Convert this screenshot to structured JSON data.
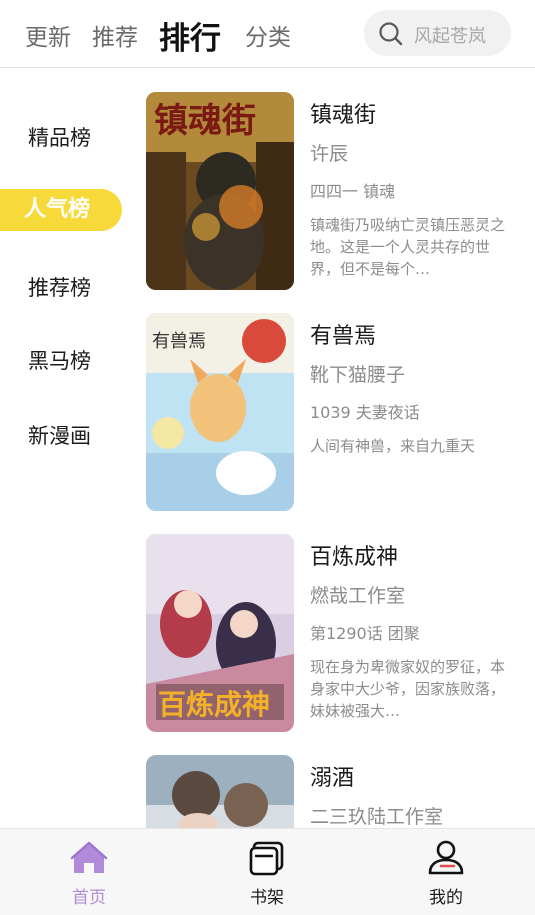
{
  "header": {
    "tabs": [
      "更新",
      "推荐",
      "排行",
      "分类"
    ],
    "active_tab": "排行",
    "search_placeholder": "风起苍岚"
  },
  "sidebar": {
    "items": [
      "精品榜",
      "人气榜",
      "推荐榜",
      "黑马榜",
      "新漫画"
    ],
    "active_item": "人气榜"
  },
  "comics": [
    {
      "title": "镇魂街",
      "author": "许辰",
      "chapter": "四四一 镇魂",
      "desc": "镇魂街乃吸纳亡灵镇压恶灵之地。这是一个人灵共存的世界，但不是每个…",
      "cover_text": "镇魂街"
    },
    {
      "title": "有兽焉",
      "author": "靴下猫腰子",
      "chapter": "1039 夫妻夜话",
      "desc": "人间有神兽，来自九重天",
      "cover_text": "有兽焉"
    },
    {
      "title": "百炼成神",
      "author": "燃哉工作室",
      "chapter": "第1290话 团聚",
      "desc": "现在身为卑微家奴的罗征，本身家中大少爷，因家族败落，妹妹被强大…",
      "cover_text": "百炼成神"
    },
    {
      "title": "溺酒",
      "author": "二三玖陆工作室",
      "chapter": "",
      "desc": "",
      "cover_text": ""
    }
  ],
  "bottom_nav": {
    "items": [
      "首页",
      "书架",
      "我的"
    ],
    "active_item": "首页",
    "active_color": "#b18bd9"
  },
  "colors": {
    "accent_yellow": "#f8d93a",
    "muted_text": "#8c8c8c"
  }
}
